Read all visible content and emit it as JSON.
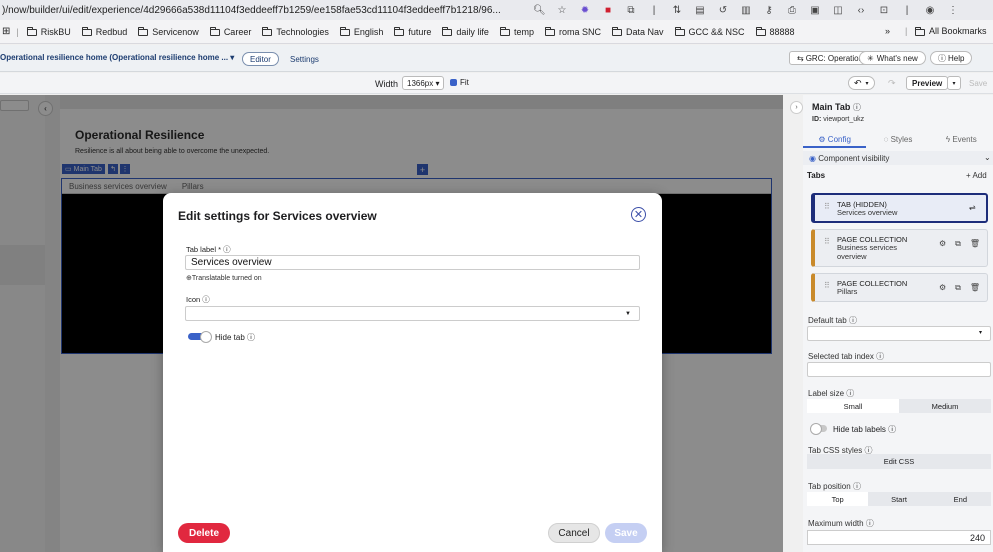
{
  "browser": {
    "url": ")/now/builder/ui/edit/experience/4d29666a538d11104f3eddeeff7b1259/ee158fae53cd11104f3eddeeff7b1218/96...",
    "bookmarks": [
      "RiskBU",
      "Redbud",
      "Servicenow",
      "Career",
      "Technologies",
      "English",
      "future",
      "daily life",
      "temp",
      "roma SNC",
      "Data Nav",
      "GCC && NSC",
      "88888"
    ],
    "more": "»",
    "all_bookmarks": "All Bookmarks"
  },
  "app_header": {
    "experience_title": "Operational resilience home (Operational resilience home ... ▾",
    "editor": "Editor",
    "settings": "Settings",
    "grc_select": "GRC: Operation... ▾",
    "whats_new": "What's new",
    "help": "Help"
  },
  "toolbar": {
    "width_label": "Width",
    "width_value": "1366px ▾",
    "fit_label": "Fit",
    "preview": "Preview",
    "save": "Save"
  },
  "canvas": {
    "title": "Operational Resilience",
    "subtitle": "Resilience is all about being able to overcome the unexpected.",
    "chip_label": "Main Tab",
    "tabs": [
      "Business services overview",
      "Pillars"
    ]
  },
  "right_panel": {
    "title": "Main Tab",
    "id_label": "ID:",
    "id_value": "viewport_ukz",
    "tabs": {
      "config": "Config",
      "styles": "Styles",
      "events": "Events"
    },
    "component_visibility": "Component visibility",
    "tabs_header": "Tabs",
    "add": "+ Add",
    "tab_cards": [
      {
        "type": "TAB (HIDDEN)",
        "name": "Services overview"
      },
      {
        "type": "PAGE COLLECTION",
        "name": "Business services overview"
      },
      {
        "type": "PAGE COLLECTION",
        "name": "Pillars"
      }
    ],
    "default_tab": "Default tab",
    "selected_tab_index": "Selected tab index",
    "label_size": "Label size",
    "label_size_options": [
      "Small",
      "Medium"
    ],
    "hide_tab_labels": "Hide tab labels",
    "tab_css_styles": "Tab CSS styles",
    "edit_css": "Edit CSS",
    "tab_position": "Tab position",
    "tab_position_options": [
      "Top",
      "Start",
      "End"
    ],
    "maximum_width": "Maximum width",
    "maximum_width_value": "240"
  },
  "modal": {
    "title": "Edit settings for Services overview",
    "tab_label_lbl": "Tab label *",
    "tab_label_value": "Services overview",
    "translatable": "Translatable turned on",
    "icon_lbl": "Icon",
    "hide_tab": "Hide tab",
    "delete": "Delete",
    "cancel": "Cancel",
    "save": "Save"
  },
  "colors": {
    "accent": "#3a62c8",
    "delete": "#e1283f",
    "card_orange": "#c98a2b",
    "card_selected": "#1d2d7a"
  }
}
